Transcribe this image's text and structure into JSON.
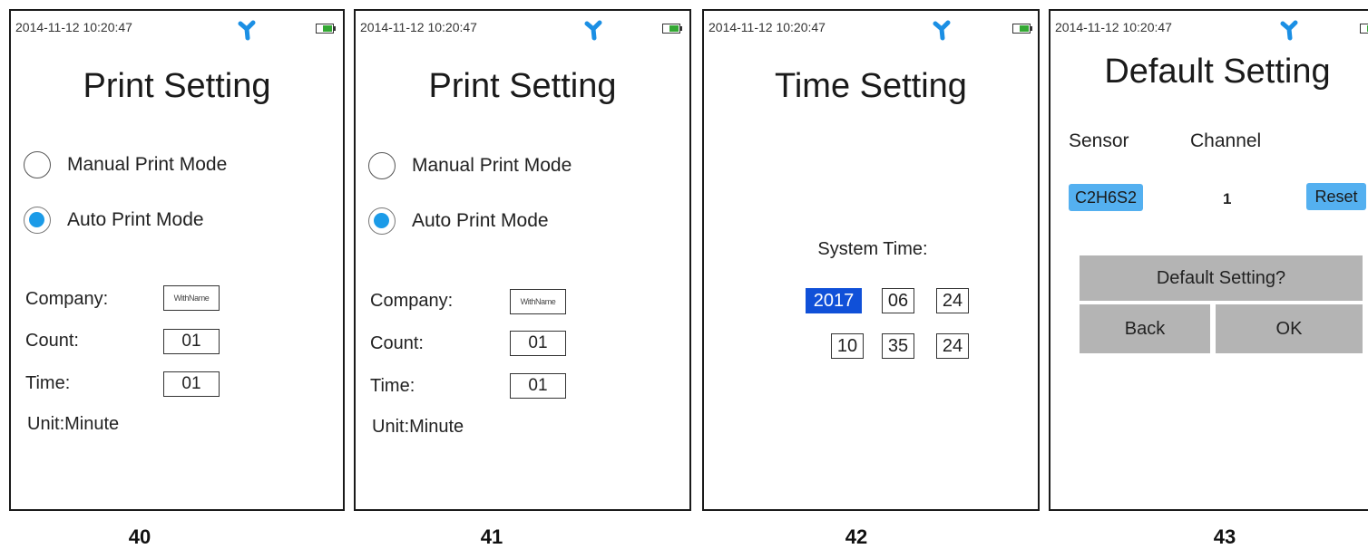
{
  "status": {
    "datetime": "2014-11-12  10:20:47"
  },
  "icons": {
    "bluetooth": "bluetooth-icon",
    "battery": "battery-icon"
  },
  "colors": {
    "radio_selected": "#1b9be8",
    "selected_field": "#1050d8",
    "chip": "#54b0f0",
    "dialog": "#b4b4b4"
  },
  "screens": [
    {
      "caption": "40",
      "title": "Print Setting",
      "modes": [
        {
          "label": "Manual Print Mode",
          "checked": false
        },
        {
          "label": "Auto Print Mode",
          "checked": true
        }
      ],
      "fields": {
        "company_label": "Company:",
        "company_value": "WithName",
        "count_label": "Count:",
        "count_value": "01",
        "time_label": "Time:",
        "time_value": "01"
      },
      "unit": "Unit:Minute"
    },
    {
      "caption": "41",
      "title": "Print Setting",
      "modes": [
        {
          "label": "Manual Print Mode",
          "checked": false
        },
        {
          "label": "Auto Print Mode",
          "checked": true
        }
      ],
      "fields": {
        "company_label": "Company:",
        "company_value": "WithName",
        "count_label": "Count:",
        "count_value": "01",
        "time_label": "Time:",
        "time_value": "01"
      },
      "unit": "Unit:Minute"
    },
    {
      "caption": "42",
      "title": "Time Setting",
      "system_time_label": "System Time:",
      "date": {
        "year": "2017",
        "month": "06",
        "day": "24"
      },
      "time": {
        "hour": "10",
        "minute": "35",
        "second": "24"
      },
      "selected_field": "year"
    },
    {
      "caption": "43",
      "title": "Default Setting",
      "headers": {
        "sensor": "Sensor",
        "channel": "Channel"
      },
      "row": {
        "sensor": "C2H6S2",
        "channel": "1",
        "reset": "Reset"
      },
      "dialog": {
        "title": "Default Setting?",
        "back": "Back",
        "ok": "OK"
      }
    }
  ]
}
